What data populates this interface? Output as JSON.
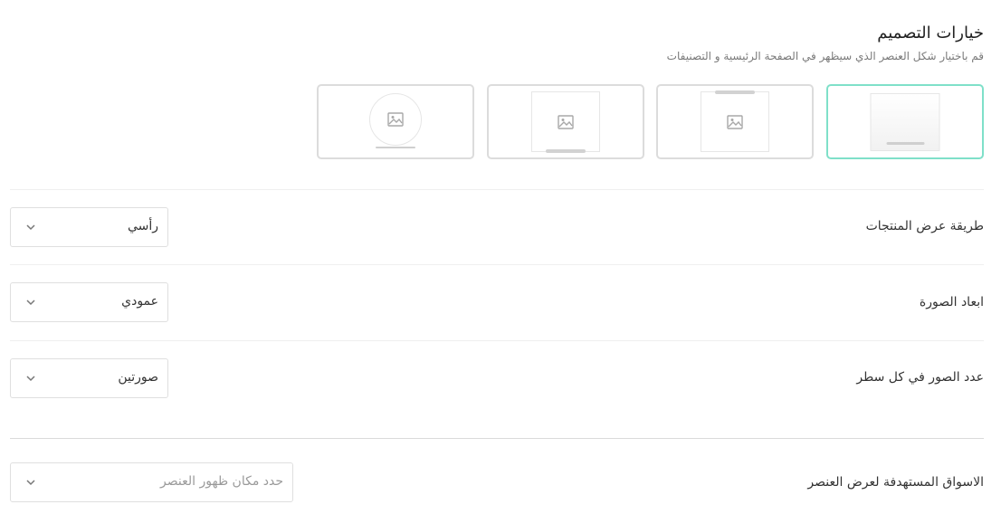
{
  "header": {
    "title": "خيارات التصميم",
    "subtitle": "قم باختيار شكل العنصر الذي سيظهر في الصفحة الرئيسية و التصنيفات"
  },
  "design_options": {
    "selected_index": 0,
    "cards": [
      {
        "name": "design-option-plain"
      },
      {
        "name": "design-option-top-bar"
      },
      {
        "name": "design-option-bottom-bar"
      },
      {
        "name": "design-option-circle"
      }
    ]
  },
  "settings": {
    "display_method": {
      "label": "طريقة عرض المنتجات",
      "value": "رأسي"
    },
    "image_dimensions": {
      "label": "ابعاد الصورة",
      "value": "عمودي"
    },
    "images_per_row": {
      "label": "عدد الصور في كل سطر",
      "value": "صورتين"
    },
    "target_markets": {
      "label": "الاسواق المستهدفة لعرض العنصر",
      "placeholder": "حدد مكان ظهور العنصر"
    }
  },
  "colors": {
    "accent": "#7fe0c9",
    "border": "#dcdcdc"
  },
  "icons": {
    "image": "image-icon",
    "chevron": "chevron-down-icon"
  }
}
